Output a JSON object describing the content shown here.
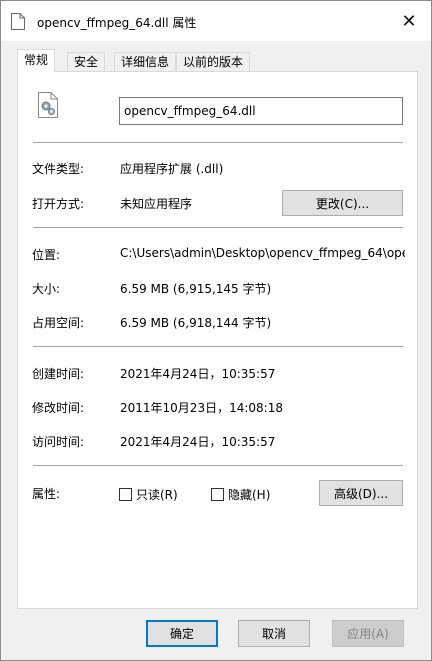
{
  "window": {
    "title": "opencv_ffmpeg_64.dll 属性",
    "close_glyph": "✕"
  },
  "tabs": [
    {
      "label": "常规",
      "active": true
    },
    {
      "label": "安全",
      "active": false
    },
    {
      "label": "详细信息",
      "active": false
    },
    {
      "label": "以前的版本",
      "active": false
    }
  ],
  "file": {
    "name": "opencv_ffmpeg_64.dll"
  },
  "type": {
    "label": "文件类型:",
    "value": "应用程序扩展 (.dll)"
  },
  "open_with": {
    "label": "打开方式:",
    "value": "未知应用程序",
    "change_button": "更改(C)..."
  },
  "location": {
    "label": "位置:",
    "value": "C:\\Users\\admin\\Desktop\\opencv_ffmpeg_64\\ope"
  },
  "size": {
    "label": "大小:",
    "value": "6.59 MB (6,915,145 字节)"
  },
  "size_on_disk": {
    "label": "占用空间:",
    "value": "6.59 MB (6,918,144 字节)"
  },
  "created": {
    "label": "创建时间:",
    "value": "2021年4月24日，10:35:57"
  },
  "modified": {
    "label": "修改时间:",
    "value": "2011年10月23日，14:08:18"
  },
  "accessed": {
    "label": "访问时间:",
    "value": "2021年4月24日，10:35:57"
  },
  "attributes": {
    "label": "属性:",
    "readonly": {
      "label": "只读(R)",
      "checked": false
    },
    "hidden": {
      "label": "隐藏(H)",
      "checked": false
    },
    "advanced_button": "高级(D)..."
  },
  "buttons": {
    "ok": "确定",
    "cancel": "取消",
    "apply": "应用(A)"
  },
  "colors": {
    "accent": "#0078d7",
    "panel": "#ffffff",
    "window": "#f0f0f0"
  }
}
